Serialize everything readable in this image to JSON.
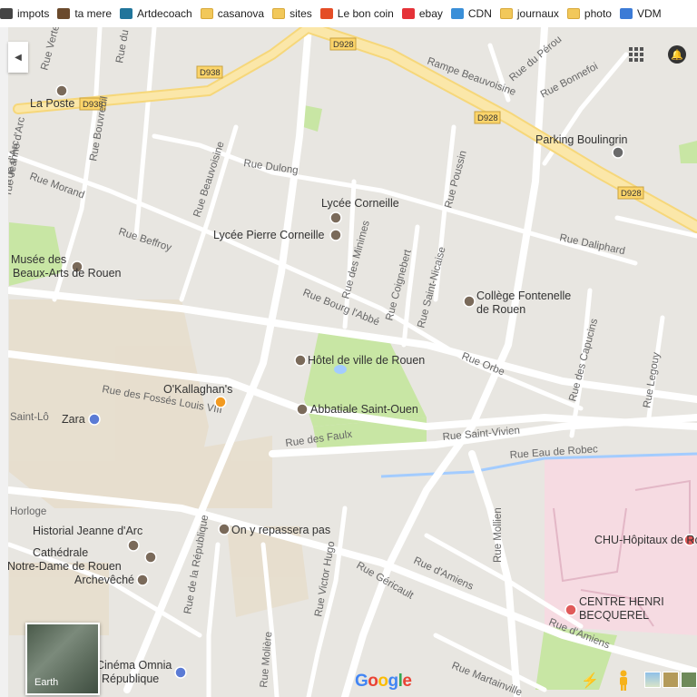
{
  "bookmarks": [
    {
      "label": "impots",
      "icon": "tax-icon",
      "color": "#444444"
    },
    {
      "label": "ta mere",
      "icon": "portrait-icon",
      "color": "#6b4a2c"
    },
    {
      "label": "Artdecoach",
      "icon": "wordpress-icon",
      "color": "#21759b"
    },
    {
      "label": "casanova",
      "icon": "folder-icon",
      "color": "#f2c85a"
    },
    {
      "label": "sites",
      "icon": "folder-icon",
      "color": "#f2c85a"
    },
    {
      "label": "Le bon coin",
      "icon": "cube-icon",
      "color": "#e44d26"
    },
    {
      "label": "ebay",
      "icon": "bag-icon",
      "color": "#e53238"
    },
    {
      "label": "CDN",
      "icon": "star-icon",
      "color": "#3a8fd8"
    },
    {
      "label": "journaux",
      "icon": "folder-icon",
      "color": "#f2c85a"
    },
    {
      "label": "photo",
      "icon": "folder-icon",
      "color": "#f2c85a"
    },
    {
      "label": "VDM",
      "icon": "vdm-icon",
      "color": "#3c7bd6"
    }
  ],
  "map": {
    "colors": {
      "background": "#e8e6e1",
      "road": "#ffffff",
      "highway": "#fbe29a",
      "park": "#c8e6a4",
      "hospital": "#f6dbe2",
      "water": "#a3ccff",
      "blocks": "#e2d8c4"
    },
    "route_shields": [
      "D938",
      "D938",
      "D928",
      "D928",
      "D928"
    ],
    "streets": [
      "Rampe Beauvoisine",
      "Rue du Pérou",
      "Rue Bonnefoi",
      "Rue Dulong",
      "Rue Beauvoisine",
      "Rue Morand",
      "Rue Bouvreuil",
      "Rue du Champ",
      "Rue Verte",
      "Rue d'Arc",
      "Rue Poussin",
      "Rue Daliphard",
      "Rue Beffroy",
      "Rue des Minimes",
      "Rue Coignebert",
      "Rue Saint-Nicaise",
      "Rue Bourg l'Abbé",
      "Rue Orbe",
      "Rue des Capucins",
      "Rue Legouy",
      "Rue des Fossés Louis VIII",
      "Rue des Faulx",
      "Rue Saint-Vivien",
      "Rue Eau de Robec",
      "Rue de la République",
      "Rue Victor Hugo",
      "Rue Géricault",
      "Rue d'Amiens",
      "Rue Mollien",
      "Rue Molière",
      "Rue Martainville",
      "Rue d'Amiens",
      "rue Jeanne d'Arc",
      "Saint-Lô",
      "Horloge"
    ],
    "places": [
      {
        "name": "La Poste",
        "icon": "post-office-icon"
      },
      {
        "name": "Parking Boulingrin",
        "icon": "parking-icon"
      },
      {
        "name": "Lycée Corneille",
        "icon": "school-icon"
      },
      {
        "name": "Lycée Pierre Corneille",
        "icon": "school-icon"
      },
      {
        "name": "Musée des Beaux-Arts de Rouen",
        "line1": "Musée des",
        "line2": "Beaux-Arts de Rouen",
        "icon": "museum-icon"
      },
      {
        "name": "Collège Fontenelle de Rouen",
        "line1": "Collège Fontenelle",
        "line2": "de Rouen",
        "icon": "school-icon"
      },
      {
        "name": "Hôtel de ville de Rouen",
        "icon": "city-hall-icon"
      },
      {
        "name": "O'Kallaghan's",
        "icon": "restaurant-icon"
      },
      {
        "name": "Abbatiale Saint-Ouen",
        "icon": "church-icon"
      },
      {
        "name": "Zara",
        "icon": "shopping-icon"
      },
      {
        "name": "Historial Jeanne d'Arc",
        "icon": "museum-icon"
      },
      {
        "name": "On y repassera pas",
        "icon": "museum-icon"
      },
      {
        "name": "Cathédrale Notre-Dame de Rouen",
        "line1": "Cathédrale",
        "line2": "Notre-Dame de Rouen",
        "icon": "church-icon"
      },
      {
        "name": "Archevêché",
        "icon": "landmark-icon"
      },
      {
        "name": "CHU-Hôpitaux de Rouen",
        "icon": "hospital-icon"
      },
      {
        "name": "CENTRE HENRI BECQUEREL",
        "line1": "CENTRE HENRI",
        "line2": "BECQUEREL",
        "icon": "hospital-icon"
      },
      {
        "name": "Cinéma Omnia République",
        "line1": "Cinéma Omnia",
        "line2": "République",
        "icon": "cinema-icon"
      }
    ],
    "earth_label": "Earth",
    "logo": "Google"
  }
}
